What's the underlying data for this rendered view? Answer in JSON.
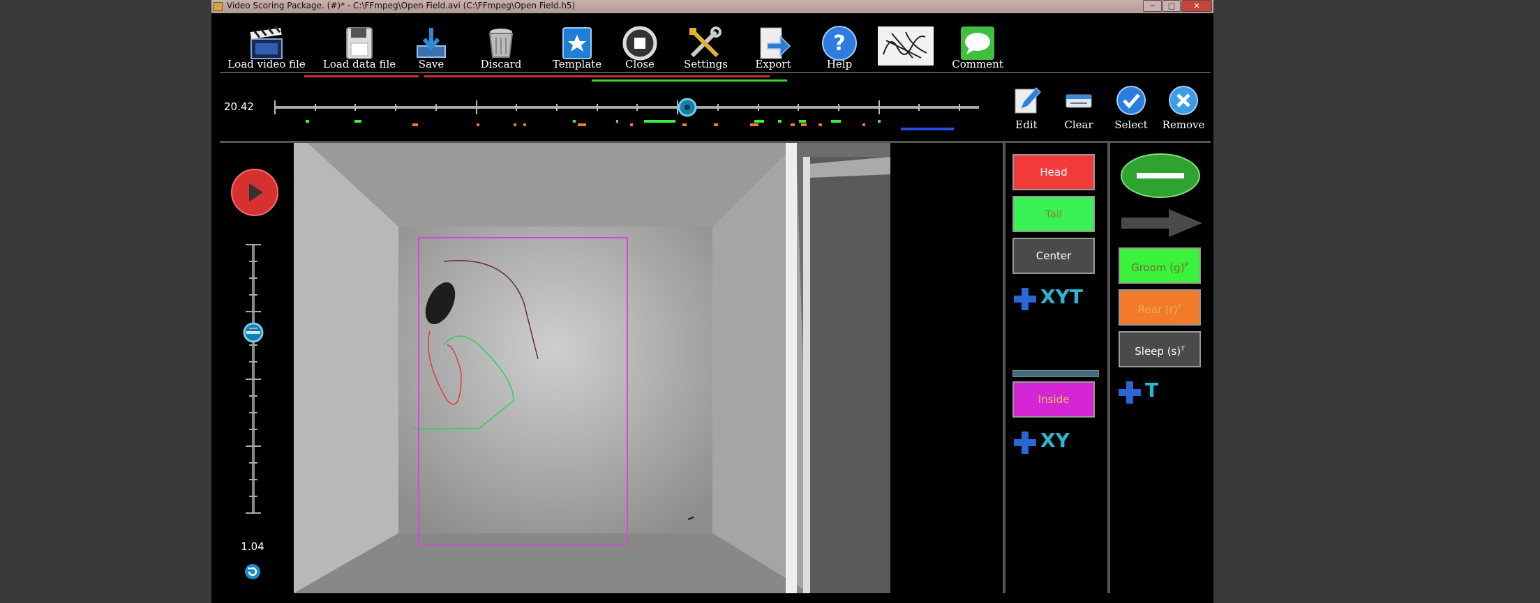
{
  "window": {
    "title": "Video Scoring Package. (#)* - C:\\FFmpeg\\Open Field.avi (C:\\FFmpeg\\Open Field.h5)",
    "min_glyph": "─",
    "max_glyph": "□",
    "close_glyph": "✕"
  },
  "toolbar": {
    "load_video": "Load video file",
    "load_data": "Load data file",
    "save": "Save",
    "discard": "Discard",
    "template": "Template",
    "close": "Close",
    "settings": "Settings",
    "export": "Export",
    "help": "Help",
    "comment": "Comment"
  },
  "timeline": {
    "time": "20.42",
    "progress": 0.586
  },
  "edit_tools": {
    "edit": "Edit",
    "clear": "Clear",
    "select": "Select",
    "remove": "Remove"
  },
  "playback": {
    "speed": "1.04",
    "speed_level": 0.33
  },
  "points": {
    "head": "Head",
    "tail": "Tail",
    "center": "Center",
    "add_xyt": "XYT",
    "inside": "Inside",
    "add_xy": "XY"
  },
  "behaviors": {
    "groom": "Groom (g)",
    "groom_sup": "P",
    "rear": "Rear (r)",
    "rear_sup": "P",
    "sleep": "Sleep (s)",
    "sleep_sup": "T",
    "add_t": "T"
  },
  "colors": {
    "head": "#f23a3a",
    "tail": "#3af256",
    "center": "#4a4a4a",
    "inside": "#d526d5",
    "groom": "#3af23a",
    "rear": "#f27a2a",
    "sleep": "#4a4a4a",
    "accent": "#2ab7d4"
  }
}
